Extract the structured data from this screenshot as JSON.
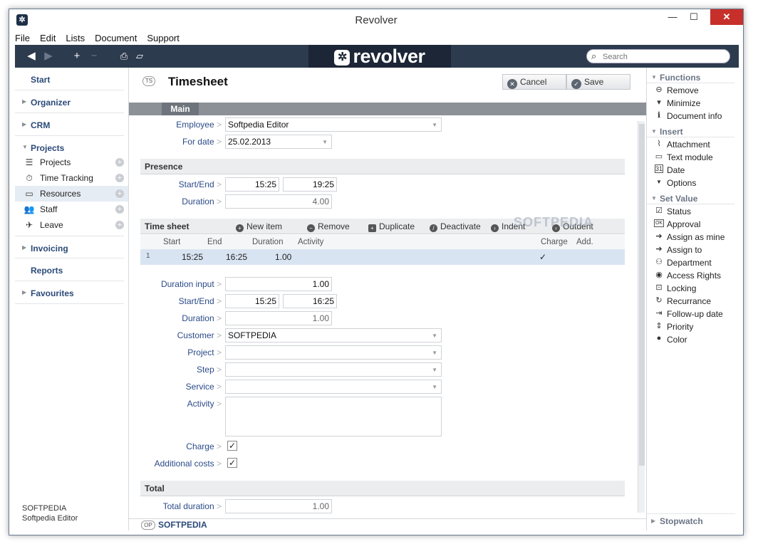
{
  "window": {
    "title": "Revolver"
  },
  "menu": [
    "File",
    "Edit",
    "Lists",
    "Document",
    "Support"
  ],
  "toolbar": {
    "logo": "revolver",
    "search_placeholder": "Search"
  },
  "nav": {
    "start": "Start",
    "organizer": "Organizer",
    "crm": "CRM",
    "projects": "Projects",
    "items": [
      "Projects",
      "Time Tracking",
      "Resources",
      "Staff",
      "Leave"
    ],
    "invoicing": "Invoicing",
    "reports": "Reports",
    "favourites": "Favourites",
    "footer_company": "SOFTPEDIA",
    "footer_user": "Softpedia Editor"
  },
  "form": {
    "badge": "TS",
    "title": "Timesheet",
    "cancel": "Cancel",
    "save": "Save",
    "tab": "Main",
    "employee_label": "Employee",
    "employee": "Softpedia Editor",
    "date_label": "For date",
    "date": "25.02.2013",
    "presence_title": "Presence",
    "startend_label": "Start/End",
    "presence_start": "15:25",
    "presence_end": "19:25",
    "duration_label": "Duration",
    "presence_duration": "4.00",
    "timesheet_title": "Time sheet",
    "actions": [
      "New item",
      "Remove",
      "Duplicate",
      "Deactivate",
      "Indent",
      "Outdent"
    ],
    "grid_cols": [
      "Start",
      "End",
      "Duration",
      "Activity",
      "Charge",
      "Add."
    ],
    "grid_row": {
      "index": "1",
      "start": "15:25",
      "end": "16:25",
      "duration": "1.00",
      "charge": "✓"
    },
    "duration_input_label": "Duration input",
    "duration_input": "1.00",
    "item_start": "15:25",
    "item_end": "16:25",
    "item_duration": "1.00",
    "customer_label": "Customer",
    "customer": "SOFTPEDIA",
    "project_label": "Project",
    "step_label": "Step",
    "service_label": "Service",
    "activity_label": "Activity",
    "charge_label": "Charge",
    "addcosts_label": "Additional costs",
    "total_title": "Total",
    "total_duration_label": "Total duration",
    "total_duration": "1.00",
    "footer_badge": "OP",
    "footer_name": "SOFTPEDIA",
    "watermark": "SOFTPEDIA"
  },
  "panel": {
    "functions": "Functions",
    "functions_items": [
      "Remove",
      "Minimize",
      "Document info"
    ],
    "insert": "Insert",
    "insert_items": [
      "Attachment",
      "Text module",
      "Date",
      "Options"
    ],
    "setvalue": "Set Value",
    "setvalue_items": [
      "Status",
      "Approval",
      "Assign as mine",
      "Assign to",
      "Department",
      "Access Rights",
      "Locking",
      "Recurrance",
      "Follow-up date",
      "Priority",
      "Color"
    ],
    "stopwatch": "Stopwatch"
  }
}
